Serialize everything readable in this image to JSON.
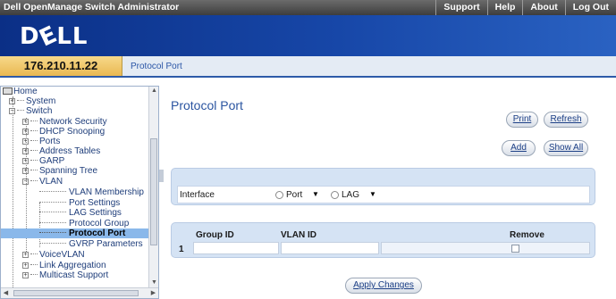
{
  "topbar": {
    "app_title": "Dell OpenManage Switch Administrator",
    "links": [
      "Support",
      "Help",
      "About",
      "Log Out"
    ]
  },
  "brand": {
    "logo": "DELL"
  },
  "ipbar": {
    "ip": "176.210.11.22",
    "breadcrumb": "Protocol Port"
  },
  "sidebar": {
    "home": "Home",
    "system": "System",
    "switch": "Switch",
    "network_security": "Network Security",
    "dhcp_snooping": "DHCP Snooping",
    "ports": "Ports",
    "address_tables": "Address Tables",
    "garp": "GARP",
    "spanning_tree": "Spanning Tree",
    "vlan": "VLAN",
    "vlan_membership": "VLAN Membership",
    "port_settings": "Port Settings",
    "lag_settings": "LAG Settings",
    "protocol_group": "Protocol Group",
    "protocol_port": "Protocol Port",
    "gvrp_parameters": "GVRP Parameters",
    "voicevlan": "VoiceVLAN",
    "link_aggregation": "Link Aggregation",
    "multicast_support": "Multicast Support"
  },
  "main": {
    "title": "Protocol Port",
    "buttons": {
      "print": "Print",
      "refresh": "Refresh",
      "add": "Add",
      "show_all": "Show All",
      "apply": "Apply Changes"
    },
    "interface": {
      "label": "Interface",
      "port_label": "Port",
      "lag_label": "LAG"
    },
    "table": {
      "headers": [
        "Group ID",
        "VLAN ID",
        "Remove"
      ],
      "rows": [
        {
          "index": "1",
          "group_id": "",
          "vlan_id": "",
          "remove": false
        }
      ]
    }
  },
  "colors": {
    "brand_blue": "#1747a8",
    "ip_gold": "#e9b852",
    "selected": "#8ab8ea",
    "panel": "#d5e3f4"
  }
}
